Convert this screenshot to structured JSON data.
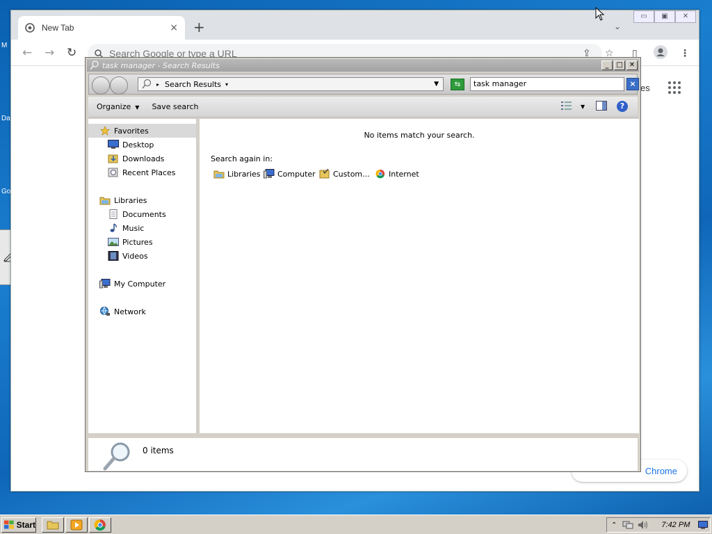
{
  "desktop": {
    "labels": [
      "M",
      "Da",
      "Go"
    ]
  },
  "chrome": {
    "tab_title": "New Tab",
    "omnibox_placeholder": "Search Google or type a URL",
    "partial_text_right": "es",
    "customize_label": "Chrome"
  },
  "explorer": {
    "title": "task manager - Search Results",
    "breadcrumb": "Search Results",
    "search_value": "task manager",
    "toolbar": {
      "organize": "Organize",
      "save_search": "Save search"
    },
    "nav": {
      "favorites": "Favorites",
      "favorites_items": [
        "Desktop",
        "Downloads",
        "Recent Places"
      ],
      "libraries": "Libraries",
      "libraries_items": [
        "Documents",
        "Music",
        "Pictures",
        "Videos"
      ],
      "computer": "My Computer",
      "network": "Network"
    },
    "content": {
      "no_items": "No items match your search.",
      "search_again": "Search again in:",
      "locations": [
        "Libraries",
        "Computer",
        "Custom...",
        "Internet"
      ]
    },
    "details": {
      "count": "0 items"
    }
  },
  "taskbar": {
    "start_label": "Start",
    "time": "7:42 PM"
  },
  "colors": {
    "desktop_blue": "#1b7fd0",
    "chrome_tabbar": "#dee1e6",
    "link_blue": "#1a73e8",
    "classic_gray": "#d4d0c8"
  }
}
